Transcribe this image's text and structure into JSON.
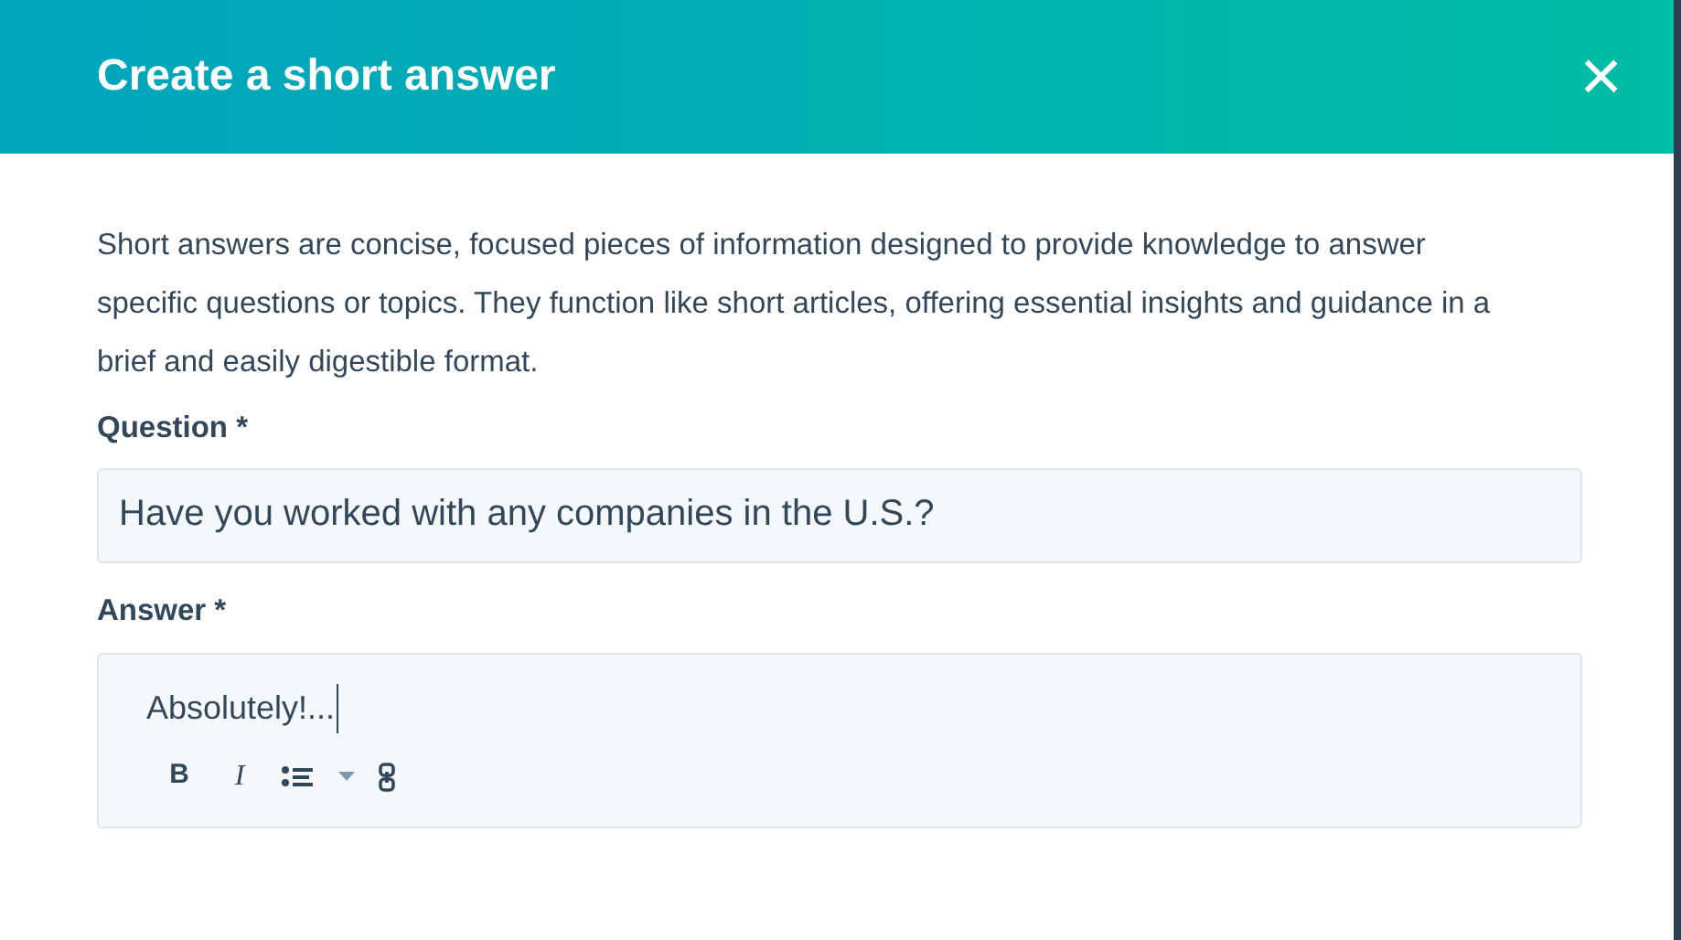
{
  "dialog": {
    "title": "Create a short answer",
    "close": "×"
  },
  "description": "Short answers are concise, focused pieces of information designed to provide knowledge to answer specific questions or topics. They function like short articles, offering essential insights and guidance in a brief and easily digestible format.",
  "question": {
    "label": "Question *",
    "value": "Have you worked with any companies in the U.S.?"
  },
  "answer": {
    "label": "Answer *",
    "value": "Absolutely!...",
    "toolbar": [
      {
        "kind": "bold",
        "label": "B"
      },
      {
        "kind": "italic",
        "label": "I"
      },
      {
        "kind": "list"
      },
      {
        "kind": "dropdown"
      },
      {
        "kind": "link"
      }
    ]
  }
}
